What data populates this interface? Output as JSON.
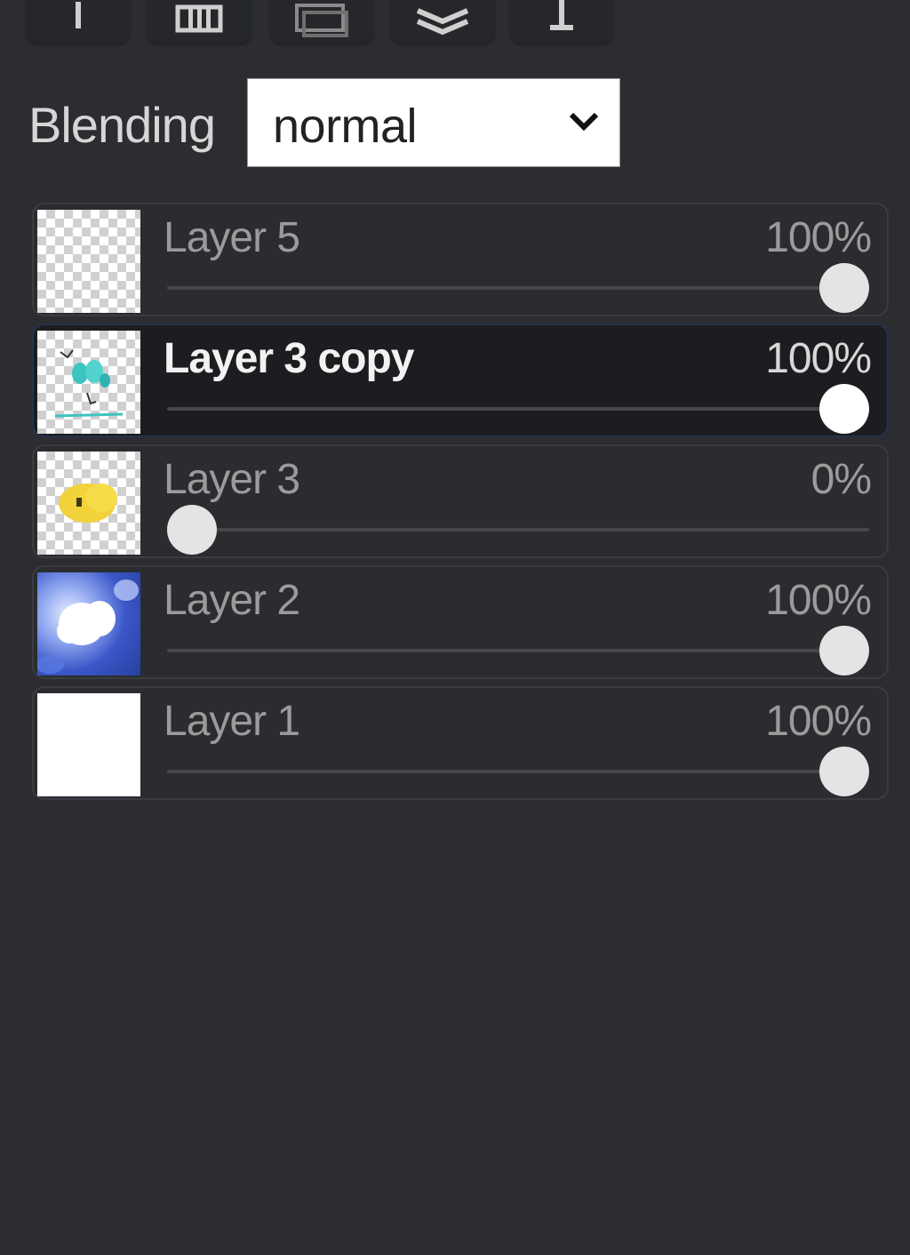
{
  "toolbar": {
    "icons": [
      "add-layer-icon",
      "delete-layer-icon",
      "duplicate-layer-icon",
      "layers-stack-icon",
      "move-layer-icon"
    ]
  },
  "blending": {
    "label": "Blending",
    "selected": "normal"
  },
  "layers": [
    {
      "name": "Layer 5",
      "opacity_label": "100%",
      "opacity": 1.0,
      "active": false,
      "thumbnail": "transparent"
    },
    {
      "name": "Layer 3 copy",
      "opacity_label": "100%",
      "opacity": 1.0,
      "active": true,
      "thumbnail": "teal-sketch"
    },
    {
      "name": "Layer 3",
      "opacity_label": "0%",
      "opacity": 0.0,
      "active": false,
      "thumbnail": "yellow-blob"
    },
    {
      "name": "Layer 2",
      "opacity_label": "100%",
      "opacity": 1.0,
      "active": false,
      "thumbnail": "blue-watercolor"
    },
    {
      "name": "Layer 1",
      "opacity_label": "100%",
      "opacity": 1.0,
      "active": false,
      "thumbnail": "white-fill"
    }
  ],
  "colors": {
    "panel_bg": "#2b2d31",
    "active_layer_bg": "#1c1d20",
    "active_border": "#23324f"
  }
}
